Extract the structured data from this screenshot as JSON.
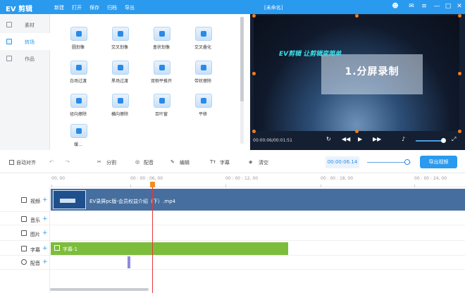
{
  "app": {
    "logo": "EV 剪辑",
    "window_title": "[未命名]"
  },
  "menu": [
    "新建",
    "打开",
    "保存",
    "归档",
    "导出"
  ],
  "window_controls": [
    "user-icon",
    "mail-icon",
    "menu-icon",
    "minimize-icon",
    "maximize-icon",
    "close-icon"
  ],
  "nav": [
    {
      "label": "素材",
      "icon": "grid-icon"
    },
    {
      "label": "转场",
      "icon": "transition-icon"
    },
    {
      "label": "作品",
      "icon": "folder-icon"
    }
  ],
  "effects": [
    "圆划像",
    "交叉划像",
    "盒状划像",
    "交叉叠化",
    "白场过渡",
    "黑场过渡",
    "双侧平推开",
    "带状擦除",
    "径向擦除",
    "横向擦除",
    "百叶窗",
    "平移",
    "缓..."
  ],
  "preview": {
    "brand": "EV剪辑 让剪辑变简单",
    "title": "1.分屏录制",
    "time": "00:00:06/00:01:51"
  },
  "toolbar": {
    "autoalign": "自动对齐",
    "split": "分割",
    "dub": "配音",
    "edit": "编辑",
    "subtitle": "字幕",
    "clear": "清空",
    "time": "00:00:06.14",
    "export": "导出视频"
  },
  "ruler": [
    "00, 00",
    "00 : 00 : 06, 00",
    "00 : 00 : 12, 00",
    "00 : 00 : 18, 00",
    "00 : 00 : 24, 00"
  ],
  "tracks": [
    {
      "label": "视频",
      "icon": "video-icon"
    },
    {
      "label": "音乐",
      "icon": "music-icon"
    },
    {
      "label": "图片",
      "icon": "image-icon"
    },
    {
      "label": "字幕",
      "icon": "text-icon"
    },
    {
      "label": "配音",
      "icon": "mic-icon"
    }
  ],
  "clips": {
    "video_name": "EV录屏pc版-会员权益介绍（下）.mp4",
    "subtitle_name": "字幕-1"
  },
  "colors": {
    "accent": "#2a9aee",
    "subtitle_clip": "#7cbd3c",
    "video_clip": "#466fa0",
    "playhead": "#e53935"
  }
}
